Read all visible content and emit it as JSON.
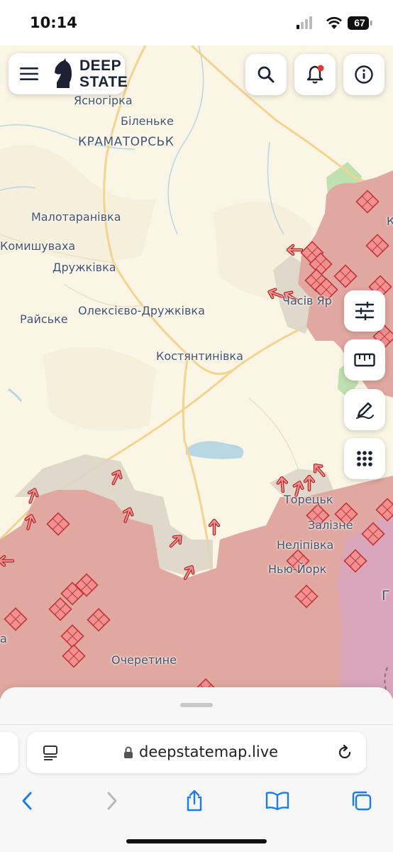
{
  "status_bar": {
    "time": "10:14",
    "battery": "67"
  },
  "header": {
    "logo_line1": "DEEP",
    "logo_line2": "STATE",
    "icons": [
      "menu-icon",
      "search-icon",
      "bell-icon",
      "info-icon"
    ]
  },
  "map": {
    "places": {
      "yasnohirka": "Ясногірка",
      "bilenke": "Біленьке",
      "kramatorsk": "КРАМАТОРСЬК",
      "malotaranivka": "Малотаранівка",
      "komyshuvakha": "Комишуваха",
      "druzhkivka": "Дружківка",
      "raiske": "Райське",
      "oleksiievo": "Олексієво-Дружківка",
      "kostiantynivka": "Костянтинівка",
      "chasiv_yar": "Часів Яр",
      "toretsk": "Торецьк",
      "zalizne": "Залізне",
      "nelipivka": "Неліпівка",
      "niu_york": "Нью-Йорк",
      "ocheretyne": "Очеретине",
      "edge_k": "К",
      "edge_g": "Г",
      "edge_a": "а"
    },
    "colors": {
      "land": "#fbf5e6",
      "occupied": "#e0a8a0",
      "contested": "#ddd5c8",
      "annexed": "#d9a6ba",
      "forest": "#bfe0b0",
      "roads": "#f2d48f"
    }
  },
  "controls": [
    "filters-icon",
    "ruler-icon",
    "draw-icon",
    "apps-grid-icon"
  ],
  "browser": {
    "url": "deepstatemap.live",
    "toolbar_icons": [
      "back-icon",
      "forward-icon",
      "share-icon",
      "bookmarks-icon",
      "tabs-icon"
    ]
  }
}
